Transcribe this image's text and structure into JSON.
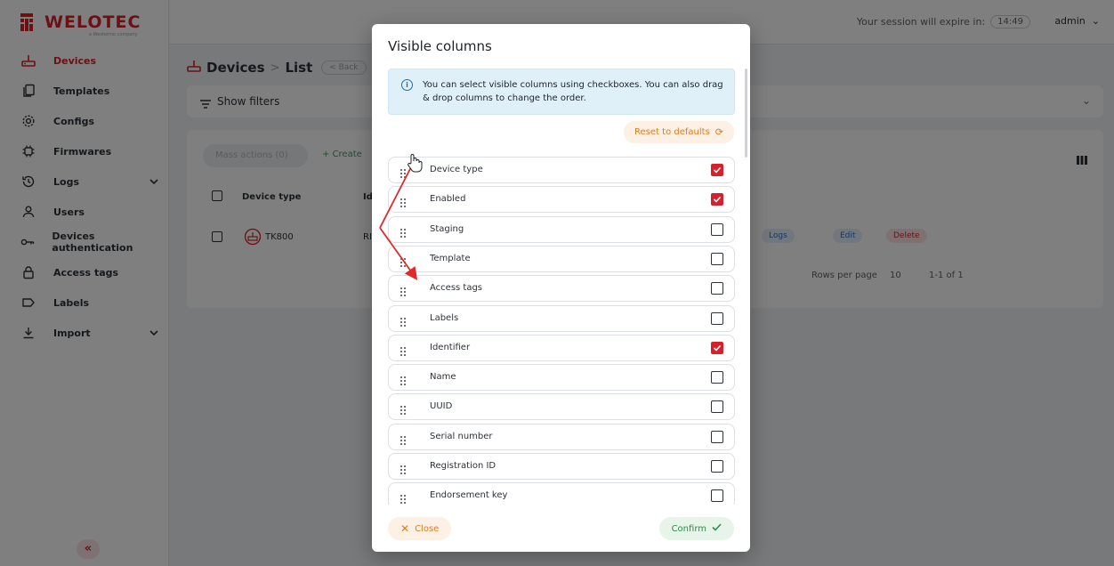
{
  "brand": {
    "name": "WELOTEC",
    "tagline": "a Westermo company"
  },
  "sidebar": {
    "items": [
      {
        "label": "Devices",
        "icon": "router-icon",
        "active": true
      },
      {
        "label": "Templates",
        "icon": "copy-icon"
      },
      {
        "label": "Configs",
        "icon": "gear-icon"
      },
      {
        "label": "Firmwares",
        "icon": "chip-icon"
      },
      {
        "label": "Logs",
        "icon": "history-icon",
        "expandable": true
      },
      {
        "label": "Users",
        "icon": "user-icon"
      },
      {
        "label": "Devices authentication",
        "icon": "key-icon"
      },
      {
        "label": "Access tags",
        "icon": "lock-icon"
      },
      {
        "label": "Labels",
        "icon": "label-icon"
      },
      {
        "label": "Import",
        "icon": "download-icon",
        "expandable": true
      }
    ],
    "collapse_label": "«"
  },
  "topbar": {
    "session_text": "Your session will expire in:",
    "timer": "14:49",
    "user": "admin"
  },
  "page": {
    "title_main": "Devices",
    "title_sep": ">",
    "title_sub": "List",
    "back_label": "< Back",
    "filters_label": "Show filters",
    "mass_actions_label": "Mass actions (0)",
    "create_label": "+ Create",
    "table": {
      "headers": [
        "Device type",
        "Id"
      ],
      "row": {
        "device_type": "TK800",
        "id_partial": "RI"
      },
      "row_actions": [
        "Logs",
        "Edit",
        "Delete"
      ]
    },
    "pagination": {
      "rows_per_page_label": "Rows per page",
      "rows_per_page": "10",
      "range": "1-1 of 1"
    }
  },
  "modal": {
    "title": "Visible columns",
    "info": "You can select visible columns using checkboxes. You can also drag & drop columns to change the order.",
    "reset_label": "Reset to defaults",
    "columns": [
      {
        "name": "Device type",
        "checked": true
      },
      {
        "name": "Enabled",
        "checked": true
      },
      {
        "name": "Staging",
        "checked": false
      },
      {
        "name": "Template",
        "checked": false
      },
      {
        "name": "Access tags",
        "checked": false
      },
      {
        "name": "Labels",
        "checked": false
      },
      {
        "name": "Identifier",
        "checked": true
      },
      {
        "name": "Name",
        "checked": false
      },
      {
        "name": "UUID",
        "checked": false
      },
      {
        "name": "Serial number",
        "checked": false
      },
      {
        "name": "Registration ID",
        "checked": false
      },
      {
        "name": "Endorsement key",
        "checked": false
      }
    ],
    "close_label": "Close",
    "confirm_label": "Confirm"
  },
  "colors": {
    "brand_red": "#d6202b",
    "confirm_green": "#2e8b4a",
    "warn_orange": "#e07b22",
    "info_blue": "#dff0f9"
  }
}
